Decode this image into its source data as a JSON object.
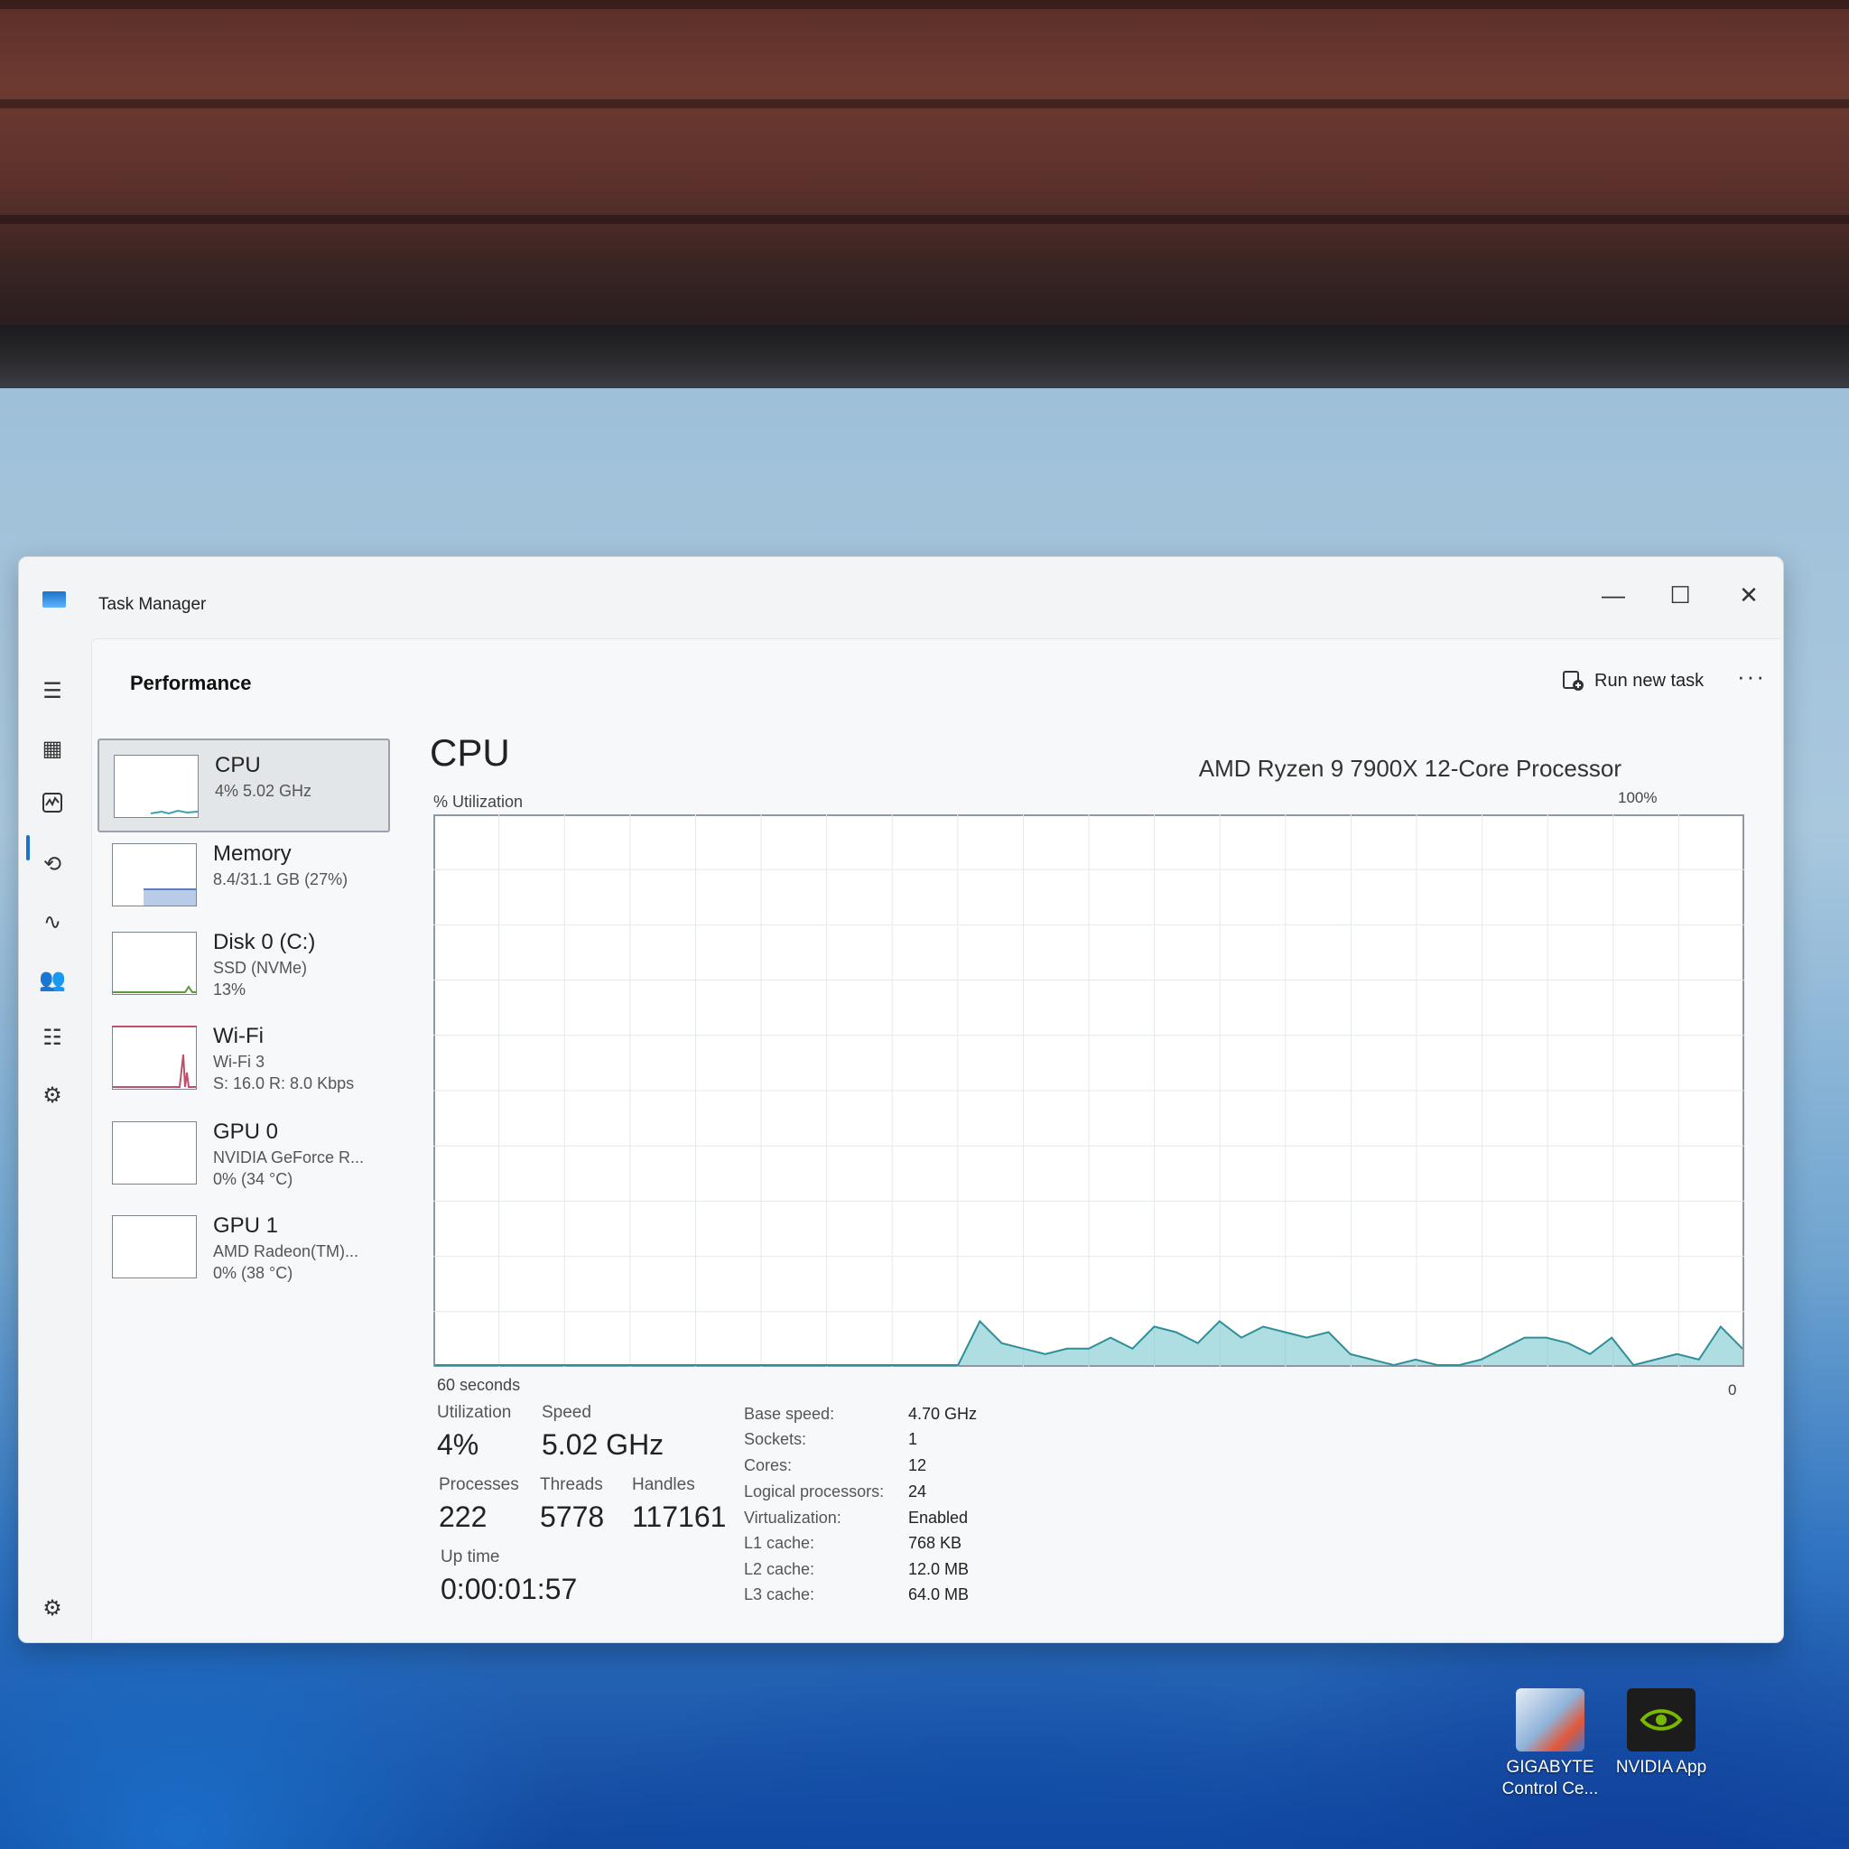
{
  "window": {
    "title": "Task Manager",
    "controls": {
      "minimize": "—",
      "maximize": "☐",
      "close": "✕"
    }
  },
  "header": {
    "page_title": "Performance",
    "run_new_task": "Run new task",
    "more": "···"
  },
  "devices": [
    {
      "name": "CPU",
      "line1": "4% 5.02 GHz",
      "line2": "",
      "selected": true
    },
    {
      "name": "Memory",
      "line1": "8.4/31.1 GB (27%)",
      "line2": "",
      "selected": false
    },
    {
      "name": "Disk 0 (C:)",
      "line1": "SSD (NVMe)",
      "line2": "13%",
      "selected": false
    },
    {
      "name": "Wi-Fi",
      "line1": "Wi-Fi 3",
      "line2": "S: 16.0 R: 8.0 Kbps",
      "selected": false
    },
    {
      "name": "GPU 0",
      "line1": "NVIDIA GeForce R...",
      "line2": "0% (34 °C)",
      "selected": false
    },
    {
      "name": "GPU 1",
      "line1": "AMD Radeon(TM)...",
      "line2": "0% (38 °C)",
      "selected": false
    }
  ],
  "cpu": {
    "title": "CPU",
    "model": "AMD Ryzen 9 7900X 12-Core Processor",
    "util_label": "% Utilization",
    "max_label": "100%",
    "time_label": "60 seconds",
    "zero_label": "0",
    "stats": {
      "utilization_label": "Utilization",
      "utilization": "4%",
      "speed_label": "Speed",
      "speed": "5.02 GHz",
      "processes_label": "Processes",
      "processes": "222",
      "threads_label": "Threads",
      "threads": "5778",
      "handles_label": "Handles",
      "handles": "117161",
      "uptime_label": "Up time",
      "uptime": "0:00:01:57"
    },
    "specs": [
      {
        "label": "Base speed:",
        "value": "4.70 GHz"
      },
      {
        "label": "Sockets:",
        "value": "1"
      },
      {
        "label": "Cores:",
        "value": "12"
      },
      {
        "label": "Logical processors:",
        "value": "24"
      },
      {
        "label": "Virtualization:",
        "value": "Enabled"
      },
      {
        "label": "L1 cache:",
        "value": "768 KB"
      },
      {
        "label": "L2 cache:",
        "value": "12.0 MB"
      },
      {
        "label": "L3 cache:",
        "value": "64.0 MB"
      }
    ],
    "graph_color": "#6cc2c8",
    "utilization_history": [
      0,
      0,
      0,
      0,
      0,
      0,
      0,
      0,
      0,
      0,
      0,
      0,
      0,
      0,
      0,
      0,
      0,
      0,
      0,
      0,
      0,
      0,
      0,
      0,
      0,
      8,
      4,
      3,
      2,
      3,
      3,
      5,
      3,
      7,
      6,
      4,
      8,
      5,
      7,
      6,
      5,
      6,
      2,
      1,
      0,
      1,
      0,
      0,
      1,
      3,
      5,
      5,
      4,
      2,
      5,
      0,
      1,
      2,
      1,
      7,
      3
    ]
  },
  "desktop_icons": [
    {
      "label": "GIGABYTE Control Ce...",
      "icon": "gigabyte-control-center-icon"
    },
    {
      "label": "NVIDIA App",
      "icon": "nvidia-app-icon"
    }
  ]
}
